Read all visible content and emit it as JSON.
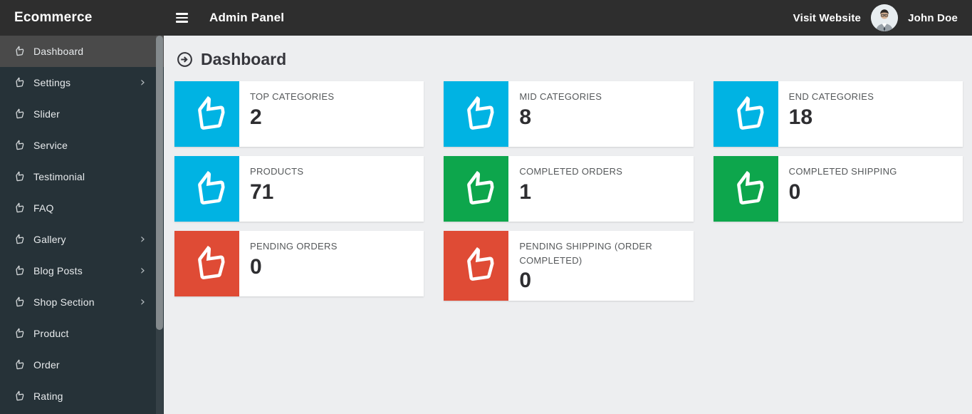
{
  "topbar": {
    "brand": "Ecommerce",
    "menu_icon": "hamburger-icon",
    "title": "Admin Panel",
    "visit_website_label": "Visit Website",
    "user_name": "John Doe",
    "avatar_icon": "user-photo-avatar"
  },
  "sidebar": {
    "item_icon": "thumbs-up-icon",
    "items": [
      {
        "label": "Dashboard",
        "active": true,
        "chevron": false
      },
      {
        "label": "Settings",
        "active": false,
        "chevron": true
      },
      {
        "label": "Slider",
        "active": false,
        "chevron": false
      },
      {
        "label": "Service",
        "active": false,
        "chevron": false
      },
      {
        "label": "Testimonial",
        "active": false,
        "chevron": false
      },
      {
        "label": "FAQ",
        "active": false,
        "chevron": false
      },
      {
        "label": "Gallery",
        "active": false,
        "chevron": true
      },
      {
        "label": "Blog Posts",
        "active": false,
        "chevron": true
      },
      {
        "label": "Shop Section",
        "active": false,
        "chevron": true
      },
      {
        "label": "Product",
        "active": false,
        "chevron": false
      },
      {
        "label": "Order",
        "active": false,
        "chevron": false
      },
      {
        "label": "Rating",
        "active": false,
        "chevron": false
      }
    ]
  },
  "main": {
    "heading": "Dashboard",
    "heading_icon": "arrow-circle-right-icon",
    "card_icon": "thumbs-up-icon",
    "cards": [
      {
        "label": "TOP CATEGORIES",
        "value": "2",
        "color": "#00b3e3"
      },
      {
        "label": "MID CATEGORIES",
        "value": "8",
        "color": "#00b3e3"
      },
      {
        "label": "END CATEGORIES",
        "value": "18",
        "color": "#00b3e3"
      },
      {
        "label": "PRODUCTS",
        "value": "71",
        "color": "#00b3e3"
      },
      {
        "label": "COMPLETED ORDERS",
        "value": "1",
        "color": "#0da64c"
      },
      {
        "label": "COMPLETED SHIPPING",
        "value": "0",
        "color": "#0da64c"
      },
      {
        "label": "PENDING ORDERS",
        "value": "0",
        "color": "#df4b35"
      },
      {
        "label": "PENDING SHIPPING (ORDER COMPLETED)",
        "value": "0",
        "color": "#df4b35"
      }
    ]
  },
  "colors": {
    "topbar_bg": "#2e2e2e",
    "sidebar_bg": "#263238",
    "sidebar_active_bg": "#4a4a4a",
    "content_bg": "#edeef0",
    "accent_cyan": "#00b3e3",
    "accent_green": "#0da64c",
    "accent_red": "#df4b35"
  }
}
